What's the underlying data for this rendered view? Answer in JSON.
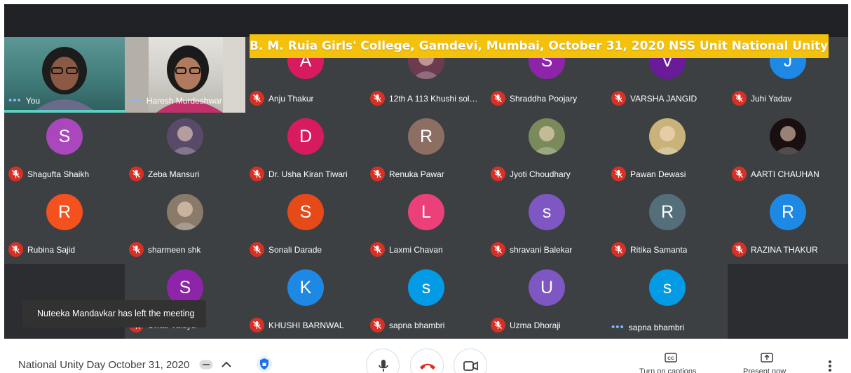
{
  "banner": {
    "text": "B. M. Ruia Girls' College, Gamdevi, Mumbai, October 31, 2020 NSS Unit National Unity Day"
  },
  "self_tile": {
    "name": "You"
  },
  "presenter_tile": {
    "name": "Haresh Murdeshwar"
  },
  "participants": [
    {
      "name": "Anju Thakur",
      "initial": "A",
      "color": "#d81b60",
      "muted": true
    },
    {
      "name": "12th A 113 Khushi sol…",
      "initial": "",
      "color": "#6d3b4f",
      "muted": true,
      "photo": true
    },
    {
      "name": "Shraddha Poojary",
      "initial": "S",
      "color": "#8e24aa",
      "muted": true
    },
    {
      "name": "VARSHA JANGID",
      "initial": "V",
      "color": "#6a1b9a",
      "muted": true
    },
    {
      "name": "Juhi Yadav",
      "initial": "J",
      "color": "#1e88e5",
      "muted": true
    },
    {
      "name": "Shagufta Shaikh",
      "initial": "S",
      "color": "#ab47bc",
      "muted": true
    },
    {
      "name": "Zeba Mansuri",
      "initial": "",
      "color": "#5a4a6a",
      "muted": true,
      "photo": true
    },
    {
      "name": "Dr. Usha Kiran Tiwari",
      "initial": "D",
      "color": "#d81b60",
      "muted": true
    },
    {
      "name": "Renuka Pawar",
      "initial": "R",
      "color": "#8d6e63",
      "muted": true
    },
    {
      "name": "Jyoti Choudhary",
      "initial": "",
      "color": "#7a8a5a",
      "muted": true,
      "photo": true
    },
    {
      "name": "Pawan Dewasi",
      "initial": "",
      "color": "#c9b37a",
      "muted": true,
      "photo": true
    },
    {
      "name": "AARTI CHAUHAN",
      "initial": "",
      "color": "#1a0f10",
      "muted": true,
      "photo": true
    },
    {
      "name": "Rubina Sajid",
      "initial": "R",
      "color": "#f4511e",
      "muted": true
    },
    {
      "name": "sharmeen shk",
      "initial": "",
      "color": "#8a7a6a",
      "muted": true,
      "photo": true
    },
    {
      "name": "Sonali Darade",
      "initial": "S",
      "color": "#e64a19",
      "muted": true
    },
    {
      "name": "Laxmi Chavan",
      "initial": "L",
      "color": "#ec407a",
      "muted": true
    },
    {
      "name": "shravani Balekar",
      "initial": "s",
      "color": "#7e57c2",
      "muted": true
    },
    {
      "name": "Ritika Samanta",
      "initial": "R",
      "color": "#546e7a",
      "muted": true
    },
    {
      "name": "RAZINA THAKUR",
      "initial": "R",
      "color": "#1e88e5",
      "muted": true
    },
    {
      "name": "Swati Vaidya",
      "initial": "S",
      "color": "#8e24aa",
      "muted": true
    },
    {
      "name": "KHUSHI BARNWAL",
      "initial": "K",
      "color": "#1e88e5",
      "muted": true
    },
    {
      "name": "sapna bhambri",
      "initial": "s",
      "color": "#039be5",
      "muted": true
    },
    {
      "name": "Uzma Dhoraji",
      "initial": "U",
      "color": "#7e57c2",
      "muted": true
    },
    {
      "name": "sapna bhambri",
      "initial": "s",
      "color": "#039be5",
      "muted": false
    }
  ],
  "toast": {
    "text": "Nuteeka Mandavkar has left the meeting"
  },
  "bottom_bar": {
    "meeting_title": "National Unity Day October 31, 2020",
    "captions_label": "Turn on captions",
    "present_label": "Present now"
  },
  "colors": {
    "mic_off": "#d93025",
    "accent_blue": "#1a73e8",
    "end_call": "#d93025"
  }
}
